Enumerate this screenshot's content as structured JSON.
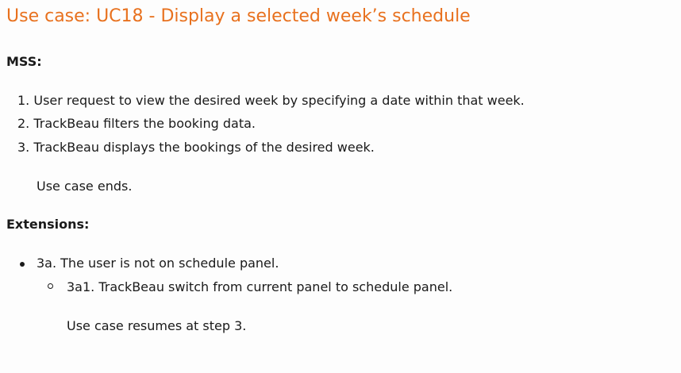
{
  "title": "Use case: UC18 - Display a selected week’s schedule",
  "mss": {
    "heading": "MSS:",
    "steps": [
      "1. User request to view the desired week by specifying a date within that week.",
      "2. TrackBeau filters the booking data.",
      "3. TrackBeau displays the bookings of the desired week."
    ],
    "end": "Use case ends."
  },
  "extensions": {
    "heading": "Extensions:",
    "items": [
      {
        "label": "3a. The user is not on schedule panel.",
        "sub": "3a1. TrackBeau switch from current panel to schedule panel.",
        "end": "Use case resumes at step 3."
      }
    ]
  },
  "colors": {
    "title": "#e8711e"
  }
}
